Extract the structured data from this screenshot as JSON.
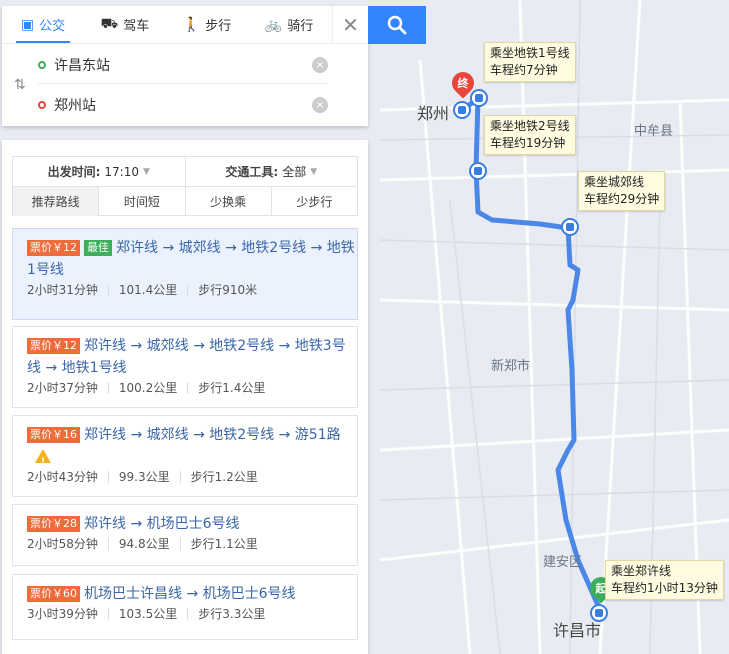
{
  "map": {
    "labels": {
      "zhengzhou": "郑州",
      "zhongmou": "中牟县",
      "xinzheng": "新郑市",
      "jianan": "建安区",
      "xuchang": "许昌市"
    },
    "callouts": {
      "metro1": [
        "乘坐地铁1号线",
        "车程约7分钟"
      ],
      "metro2": [
        "乘坐地铁2号线",
        "车程约19分钟"
      ],
      "chengjiao": [
        "乘坐城郊线",
        "车程约29分钟"
      ],
      "zhengxu": [
        "乘坐郑许线",
        "车程约1小时13分钟"
      ]
    },
    "markers": {
      "end": "终",
      "start": "起"
    },
    "route_color": "#4a87e6"
  },
  "topbar": {
    "modes": [
      {
        "label": "公交",
        "icon": "bus-icon",
        "active": true
      },
      {
        "label": "驾车",
        "icon": "car-icon",
        "active": false
      },
      {
        "label": "步行",
        "icon": "walk-icon",
        "active": false
      },
      {
        "label": "骑行",
        "icon": "bike-icon",
        "active": false
      }
    ],
    "origin": "许昌东站",
    "destination": "郑州站",
    "close": "✕"
  },
  "filters": {
    "depart_label": "出发时间:",
    "depart_value": "17:10",
    "tool_label": "交通工具:",
    "tool_value": "全部",
    "tabs": [
      "推荐路线",
      "时间短",
      "少换乘",
      "少步行"
    ]
  },
  "routes": [
    {
      "price": "票价￥12",
      "best": "最佳",
      "text": "郑许线 → 城郊线 → 地铁2号线 → 地铁1号线",
      "duration": "2小时31分钟",
      "distance": "101.4公里",
      "walk": "步行910米"
    },
    {
      "price": "票价￥12",
      "text": "郑许线 → 城郊线 → 地铁2号线 → 地铁3号线 → 地铁1号线",
      "duration": "2小时37分钟",
      "distance": "100.2公里",
      "walk": "步行1.4公里"
    },
    {
      "price": "票价￥16",
      "text": "郑许线 → 城郊线 → 地铁2号线 → 游51路",
      "duration": "2小时43分钟",
      "distance": "99.3公里",
      "walk": "步行1.2公里"
    },
    {
      "price": "票价￥28",
      "text": "郑许线 → 机场巴士6号线",
      "duration": "2小时58分钟",
      "distance": "94.8公里",
      "walk": "步行1.1公里"
    },
    {
      "price": "票价￥60",
      "text": "机场巴士许昌线 → 机场巴士6号线",
      "duration": "3小时39分钟",
      "distance": "103.5公里",
      "walk": "步行3.3公里"
    }
  ],
  "colors": {
    "accent": "#3385ff",
    "price_badge": "#ed6c3a",
    "best_badge": "#3dae5a",
    "link_text": "#3a66a8"
  }
}
